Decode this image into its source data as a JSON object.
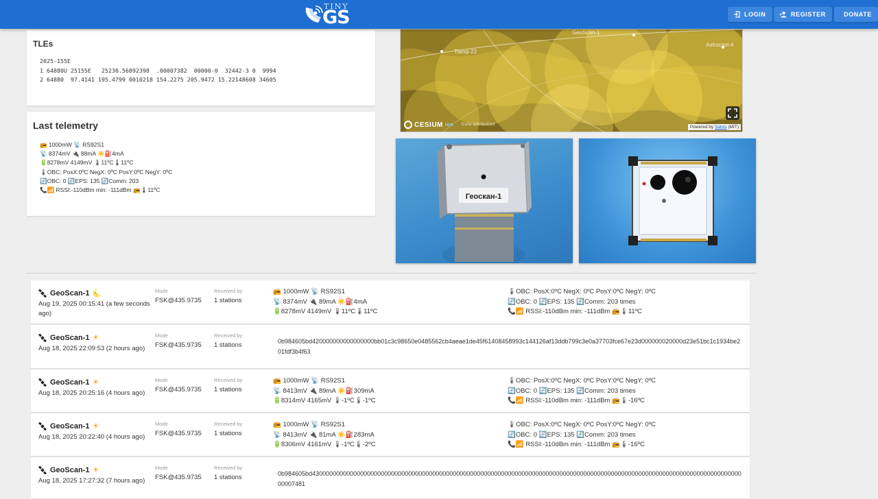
{
  "header": {
    "logo_small": "TINY",
    "logo_big": "GS",
    "login": "LOGIN",
    "register": "REGISTER",
    "donate": "DONATE",
    "brand_color": "#1e6fd1"
  },
  "tle": {
    "title": "TLEs",
    "line0": "2025-155E",
    "line1": "1 64880U 25155E   25230.56892398  .00007382  00000-0  32442-3 0  9994",
    "line2": "2 64880  97.4141 195.4799 0010218 154.2275 205.9472 15.22148608 34605"
  },
  "telemetry": {
    "title": "Last telemetry",
    "lines": [
      "📻 1000mW 📡 RS92S1",
      "📡 8374mV  🔌 88mA  ☀️⛽4mA",
      "🔋8278mV   4149mV  🌡11ºC🌡11ºC",
      "🌡OBC: PosX:0ºC NegX: 0ºC    PosY:0ºC NegY: 0ºC",
      "🔄OBC: 0 🔄EPS: 135 🔄Comm: 203",
      "📞📶 RSSI:-110dBm min: -111dBm      📻🌡11ºC"
    ]
  },
  "map": {
    "labels": [
      "GeoScan-1",
      "Tianqi-22",
      "Astrocast-4"
    ],
    "cesium": "CESIUM",
    "cesium_suffix": "ion",
    "attribution": "Data attribution",
    "powered_prefix": "Powered by ",
    "powered_link": "Satvis",
    "powered_suffix": " (MIT)"
  },
  "photo": {
    "label": "Геоскан-1"
  },
  "packets": [
    {
      "name": "GeoScan-1",
      "date": "Aug 19, 2025 00:15:41 (a few seconds ago)",
      "mode_label": "Mode",
      "mode": "FSK@435.9735",
      "recv_label": "Received by",
      "recv": "1 stations",
      "daylight": "night",
      "a": [
        "📻 1000mW 📡 RS92S1",
        "📡 8374mV  🔌 89mA  ☀️⛽4mA",
        "🔋8278mV   4149mV  🌡11ºC🌡11ºC"
      ],
      "b": [
        "🌡OBC: PosX:0ºC NegX: 0ºC    PosY:0ºC NegY: 0ºC",
        "🔄OBC: 0 🔄EPS: 135 🔄Comm: 203 times",
        "📞📶 RSSI:-110dBm min: -111dBm      📻🌡11ºC"
      ]
    },
    {
      "name": "GeoScan-1",
      "date": "Aug 18, 2025 22:09:53 (2 hours ago)",
      "mode_label": "Mode",
      "mode": "FSK@435.9735",
      "recv_label": "Received by",
      "recv": "1 stations",
      "daylight": "day",
      "raw": "0b984605bd420000000000000000bb01c3c98650e0485562cb4aeae1de45f61408458993c144126af13ddb799c3e0a37703fce67e23d000000020000d23e51bc1c1934be201fdf3b4f63"
    },
    {
      "name": "GeoScan-1",
      "date": "Aug 18, 2025 20:25:16 (4 hours ago)",
      "mode_label": "Mode",
      "mode": "FSK@435.9735",
      "recv_label": "Received by",
      "recv": "1 stations",
      "daylight": "day",
      "a": [
        "📻 1000mW 📡 RS92S1",
        "📡 8413mV  🔌 89mA  ☀️⛽309mA",
        "🔋8314mV   4165mV  🌡-1ºC🌡-1ºC"
      ],
      "b": [
        "🌡OBC: PosX:0ºC NegX: 0ºC    PosY:0ºC NegY: 0ºC",
        "🔄OBC: 0 🔄EPS: 135 🔄Comm: 203 times",
        "📞📶 RSSI:-110dBm min: -111dBm      📻🌡-16ºC"
      ]
    },
    {
      "name": "GeoScan-1",
      "date": "Aug 18, 2025 20:22:40 (4 hours ago)",
      "mode_label": "Mode",
      "mode": "FSK@435.9735",
      "recv_label": "Received by",
      "recv": "1 stations",
      "daylight": "day",
      "a": [
        "📻 1000mW 📡 RS92S1",
        "📡 8413mV  🔌 81mA  ☀️⛽283mA",
        "🔋8306mV   4161mV  🌡-1ºC🌡-2ºC"
      ],
      "b": [
        "🌡OBC: PosX:0ºC NegX: 0ºC    PosY:0ºC NegY: 0ºC",
        "🔄OBC: 0 🔄EPS: 135 🔄Comm: 203 times",
        "📞📶 RSSI:-110dBm min: -111dBm      📻🌡-16ºC"
      ]
    },
    {
      "name": "GeoScan-1",
      "date": "Aug 18, 2025 17:27:32 (7 hours ago)",
      "mode_label": "Mode",
      "mode": "FSK@435.9735",
      "recv_label": "Received by",
      "recv": "1 stations",
      "daylight": "day",
      "raw": "0b984605bd4300000000000000000000000000000000000000000000000000000000000000000000000000000000000000000000000000000000000000000000000000000007481"
    }
  ]
}
